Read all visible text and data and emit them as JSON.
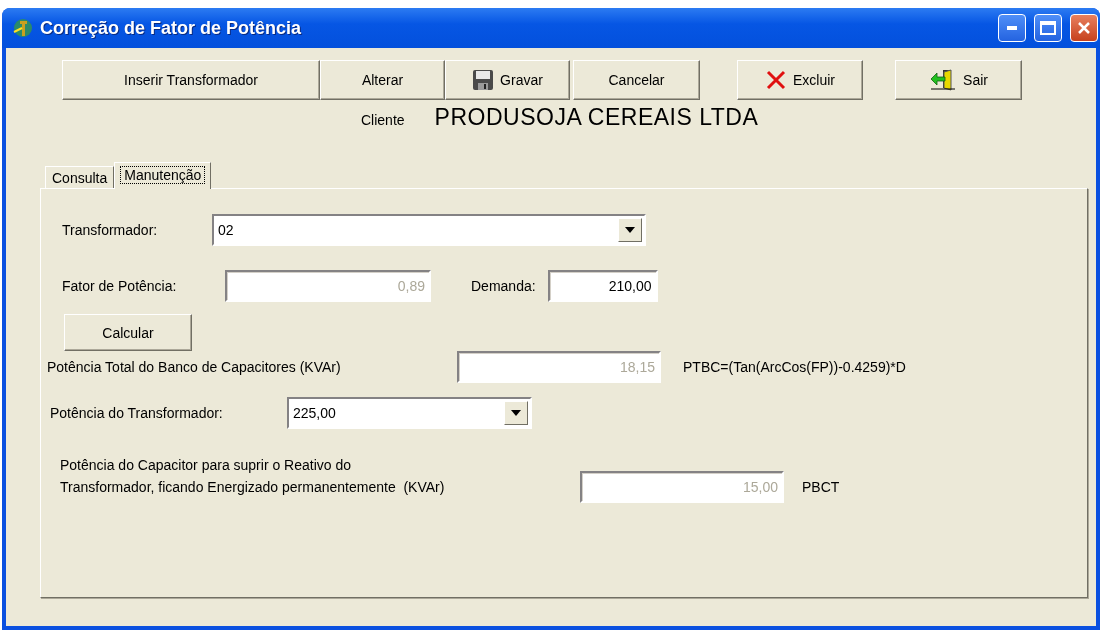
{
  "window": {
    "title": "Correção de Fator de Potência"
  },
  "toolbar": [
    {
      "label": "Inserir Transformador",
      "kind": "plain"
    },
    {
      "label": "Alterar",
      "kind": "plain"
    },
    {
      "label": "Gravar",
      "kind": "save"
    },
    {
      "label": "Cancelar",
      "kind": "plain"
    },
    {
      "label": "Excluir",
      "kind": "delete"
    },
    {
      "label": "Sair",
      "kind": "exit"
    }
  ],
  "client": {
    "label": "Cliente",
    "name": "PRODUSOJA CEREAIS LTDA"
  },
  "tabs": [
    {
      "label": "Consulta",
      "selected": false
    },
    {
      "label": "Manutenção",
      "selected": true
    }
  ],
  "form": {
    "transformer": {
      "label": "Transformador:",
      "value": "02"
    },
    "power_factor": {
      "label": "Fator de Potência:",
      "value": "0,89",
      "disabled": true
    },
    "demand": {
      "label": "Demanda:",
      "value": "210,00",
      "disabled": false
    },
    "calculate_button": "Calcular",
    "capacitor_bank": {
      "label": "Potência Total do Banco de Capacitores (KVAr)",
      "value": "18,15",
      "disabled": true,
      "formula": "PTBC=(Tan(ArcCos(FP))-0.4259)*D"
    },
    "transformer_power": {
      "label": "Potência do Transformador:",
      "value": "225,00"
    },
    "capacitor_power": {
      "label_lines": [
        "Potência do Capacitor para suprir o Reativo do",
        "Transformador, ficando Energizado permanentemente  (KVAr)"
      ],
      "value": "15,00",
      "disabled": true,
      "formula": "PBCT"
    }
  }
}
